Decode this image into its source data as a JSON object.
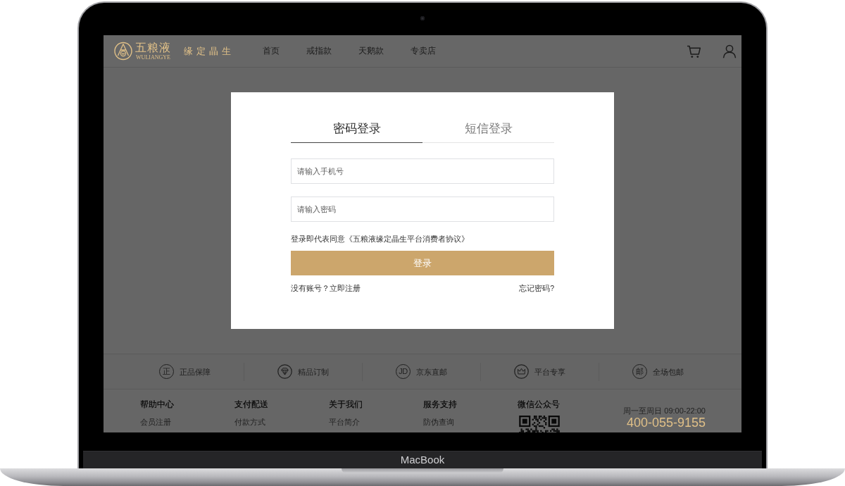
{
  "device": {
    "label": "MacBook"
  },
  "header": {
    "logo": {
      "name": "五粮液",
      "latin": "WULIANGYE",
      "slogan": "缘定晶生"
    },
    "nav": [
      {
        "label": "首页"
      },
      {
        "label": "戒指款"
      },
      {
        "label": "天鹅款"
      },
      {
        "label": "专卖店"
      }
    ]
  },
  "login": {
    "tabs": [
      {
        "label": "密码登录",
        "selected": true
      },
      {
        "label": "短信登录",
        "selected": false
      }
    ],
    "fields": [
      {
        "placeholder": "请输入手机号"
      },
      {
        "placeholder": "请输入密码"
      }
    ],
    "agreement": "登录即代表同意《五粮液缘定晶生平台消费者协议》",
    "submit": "登录",
    "register_prompt": "没有账号？",
    "register_link": "立即注册",
    "forgot_link": "忘记密码?"
  },
  "features": [
    {
      "kind": "glyph",
      "glyph": "正",
      "label": "正品保障"
    },
    {
      "kind": "diamond",
      "label": "精品订制"
    },
    {
      "kind": "glyph",
      "glyph": "JD",
      "label": "京东直邮"
    },
    {
      "kind": "crown",
      "label": "平台专享"
    },
    {
      "kind": "glyph",
      "glyph": "邮",
      "label": "全场包邮"
    }
  ],
  "footer": {
    "columns": [
      {
        "kind": "links",
        "heading": "帮助中心",
        "links": [
          "会员注册"
        ]
      },
      {
        "kind": "links",
        "heading": "支付配送",
        "links": [
          "付款方式"
        ]
      },
      {
        "kind": "links",
        "heading": "关于我们",
        "links": [
          "平台简介"
        ]
      },
      {
        "kind": "links",
        "heading": "服务支持",
        "links": [
          "防伪查询"
        ]
      },
      {
        "kind": "qr",
        "heading": "微信公众号"
      }
    ],
    "hours": "周一至周日 09:00-22:00",
    "phone": "400-055-9155"
  }
}
